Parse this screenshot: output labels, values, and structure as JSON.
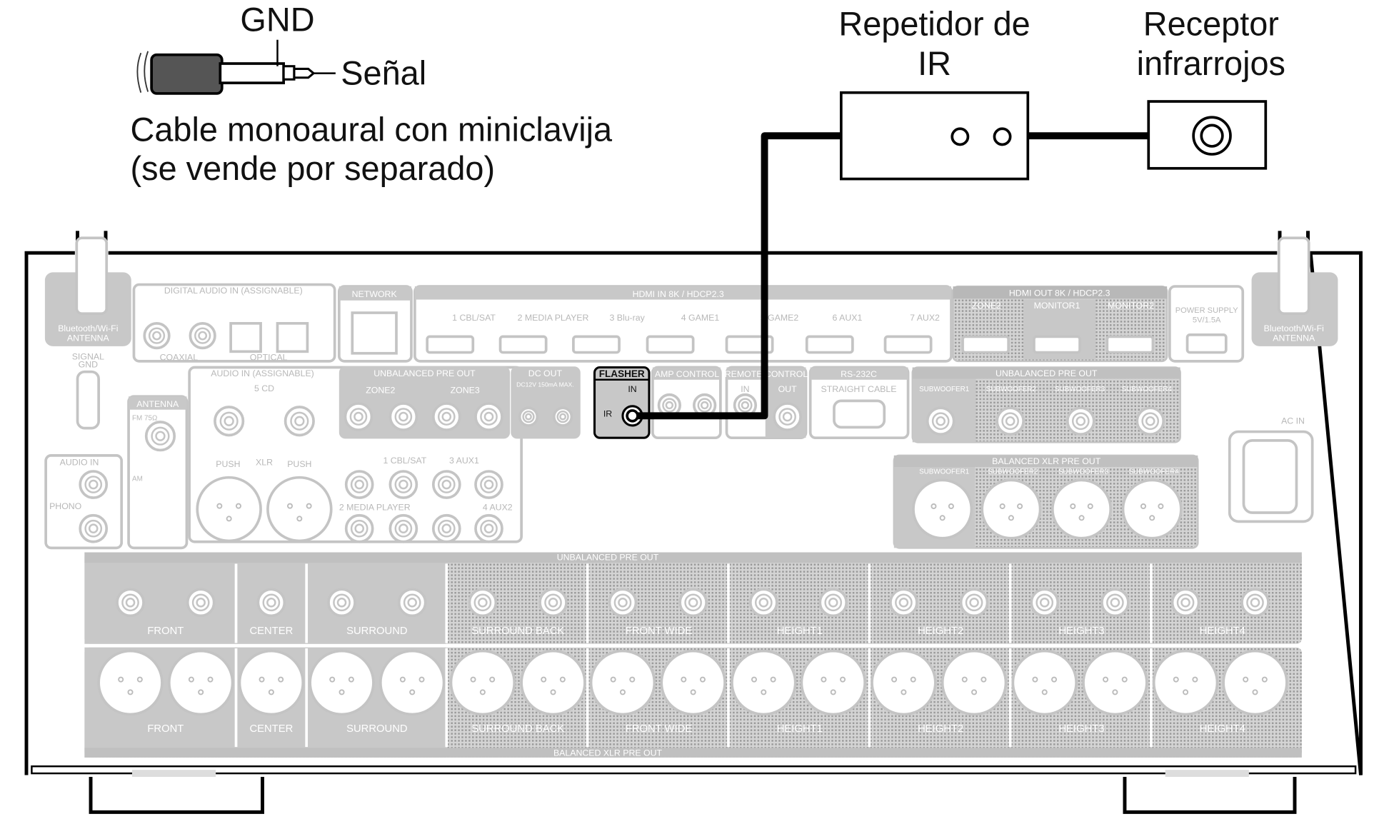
{
  "plug": {
    "gnd": "GND",
    "signal": "Señal",
    "cable_line1": "Cable monoaural con miniclavija",
    "cable_line2": "(se vende por separado)"
  },
  "repeater": {
    "line1": "Repetidor de",
    "line2": "IR"
  },
  "receiver": {
    "line1": "Receptor",
    "line2": "infrarrojos"
  },
  "panel": {
    "bt_antenna": "Bluetooth/Wi-Fi",
    "bt_antenna2": "ANTENNA",
    "digital_audio_in": "DIGITAL AUDIO IN (ASSIGNABLE)",
    "coaxial": "COAXIAL",
    "optical": "OPTICAL",
    "network": "NETWORK",
    "hdmi_in": "HDMI IN 8K / HDCP2.3",
    "hdmi_in_items": [
      "1 CBL/SAT",
      "2 MEDIA PLAYER",
      "3 Blu-ray",
      "4 GAME1",
      "5 GAME2",
      "6 AUX1",
      "7 AUX2"
    ],
    "hdmi_out": "HDMI OUT 8K / HDCP2.3",
    "hdmi_out_items": [
      "ZONE2",
      "MONITOR1",
      "MONITOR2"
    ],
    "power_supply": "POWER SUPPLY",
    "power_rating": "5V/1.5A",
    "signal_gnd": "SIGNAL",
    "signal_gnd2": "GND",
    "audio_in": "AUDIO IN (ASSIGNABLE)",
    "cd": "5 CD",
    "xlr": "XLR",
    "push": "PUSH",
    "antenna": "ANTENNA",
    "fm": "FM 75Ω",
    "am": "AM",
    "audio_in_phono": "AUDIO IN",
    "phono": "PHONO",
    "unbalanced_pre_out": "UNBALANCED PRE OUT",
    "zone2": "ZONE2",
    "zone3": "ZONE3",
    "dc_out": "DC OUT",
    "dc_rating": "DC12V 150mA MAX.",
    "flasher": "FLASHER",
    "flasher_in": "IN",
    "flasher_ir": "IR",
    "amp_control": "AMP CONTROL",
    "remote_control": "REMOTE CONTROL",
    "remote_in": "IN",
    "remote_out": "OUT",
    "rs232c": "RS-232C",
    "straight_cable": "STRAIGHT CABLE",
    "subwoofers": [
      "SUBWOOFER1",
      "SUBWOOFER2",
      "SUBWOOFER3",
      "SUBWOOFER4"
    ],
    "balanced_xlr_pre_out": "BALANCED XLR PRE OUT",
    "ac_in": "AC IN",
    "aux_inputs": [
      "1 CBL/SAT",
      "3 AUX1",
      "2 MEDIA PLAYER",
      "4 AUX2"
    ],
    "channels": [
      "FRONT",
      "CENTER",
      "SURROUND",
      "SURROUND BACK",
      "FRONT WIDE",
      "HEIGHT1",
      "HEIGHT2",
      "HEIGHT3",
      "HEIGHT4"
    ]
  }
}
